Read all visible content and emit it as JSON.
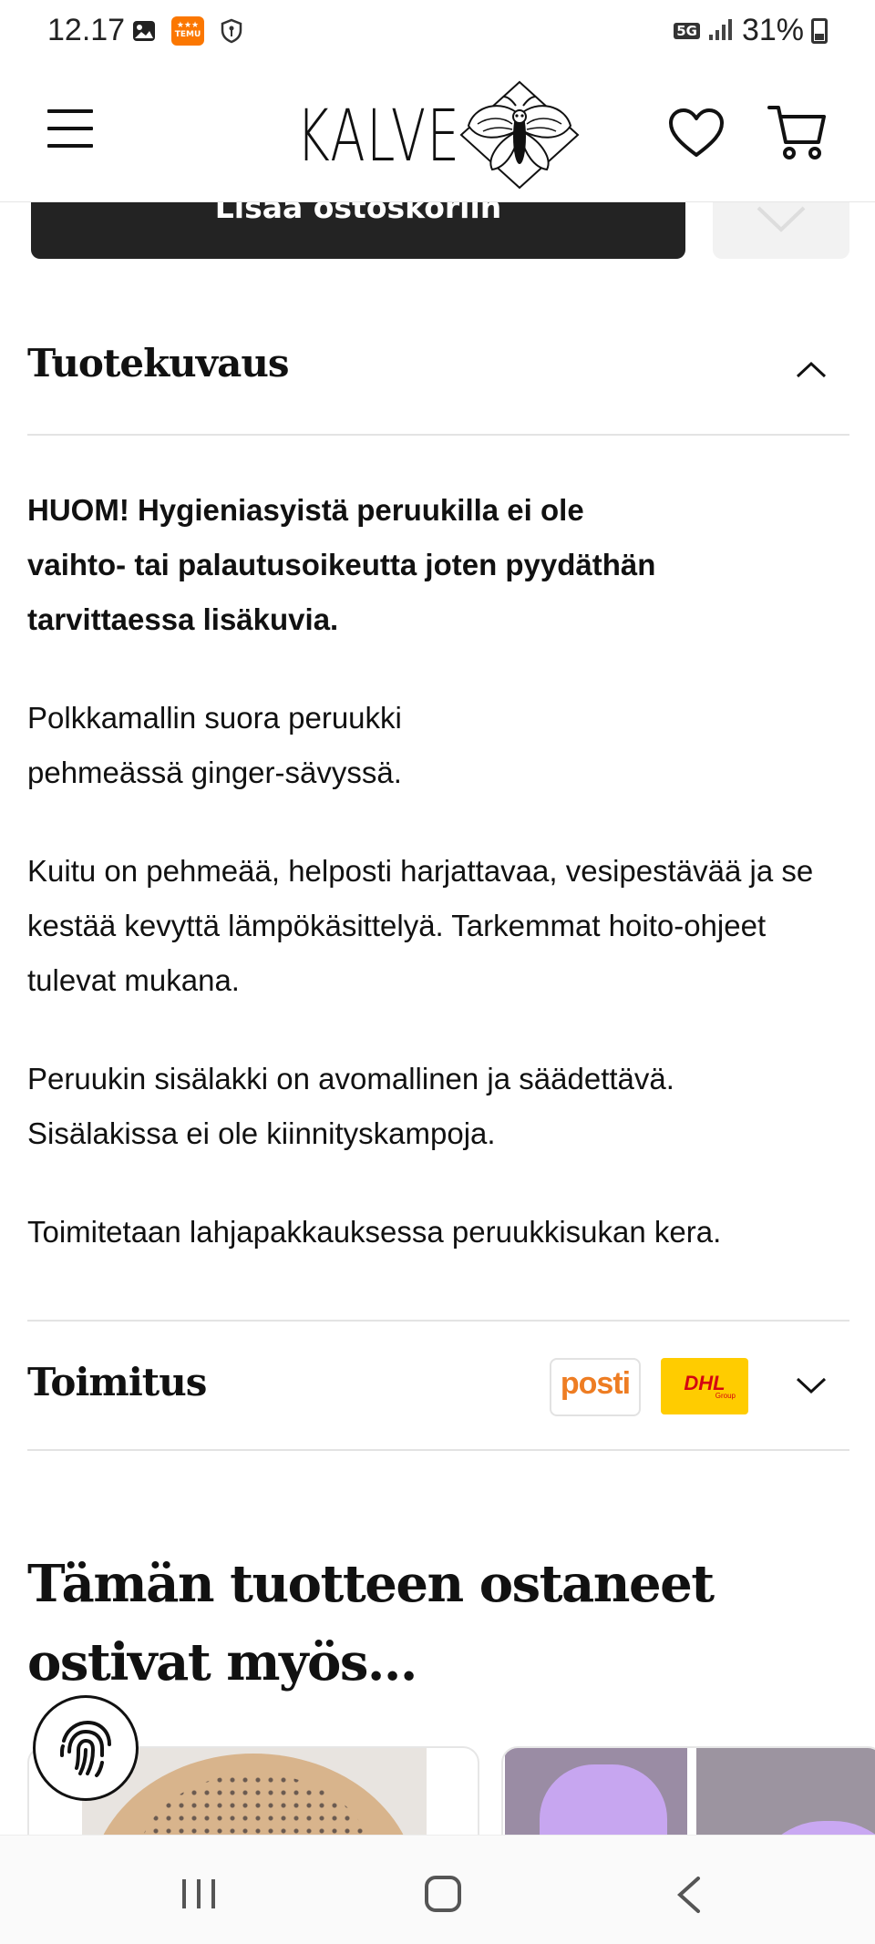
{
  "status_bar": {
    "time": "12.17",
    "notification_icons": [
      "gallery-icon",
      "temu-icon",
      "shield-icon"
    ],
    "temu_label": "TEMU",
    "network": "5G",
    "battery": "31%"
  },
  "header": {
    "logo_text": "KALVE",
    "icons": [
      "menu-icon",
      "moth-logo-icon",
      "heart-icon",
      "cart-icon"
    ]
  },
  "product": {
    "add_to_cart_label": "Lisää ostoskoriin"
  },
  "description_section": {
    "title": "Tuotekuvaus",
    "expanded": true,
    "warning": "HUOM! Hygieniasyistä peruukilla ei ole vaihto- tai palautusoikeutta joten pyydäthän tarvittaessa lisäkuvia.",
    "paragraphs": [
      "Polkkamallin suora peruukki pehmeässä ginger-sävyssä.",
      "Kuitu on pehmeää, helposti harjattavaa, vesipestävää ja se kestää kevyttä lämpökäsittelyä. Tarkemmat hoito-ohjeet tulevat mukana.",
      "Peruukin sisälakki on avomallinen ja säädettävä. Sisälakissa ei ole kiinnityskampoja.",
      "Toimitetaan lahjapakkauksessa peruukkisukan kera."
    ]
  },
  "shipping_section": {
    "title": "Toimitus",
    "expanded": false,
    "carriers": [
      {
        "name": "posti",
        "color": "#ee7d23"
      },
      {
        "name": "DHL",
        "sub": "Group",
        "color": "#d40511",
        "background": "#ffcc00"
      }
    ]
  },
  "related": {
    "title": "Tämän tuotteen ostaneet ostivat myös..."
  },
  "colors": {
    "button_dark": "#232323",
    "divider": "#e3e3e3"
  },
  "nav_bar": {
    "icons": [
      "recent-apps-icon",
      "home-icon",
      "back-icon"
    ]
  }
}
